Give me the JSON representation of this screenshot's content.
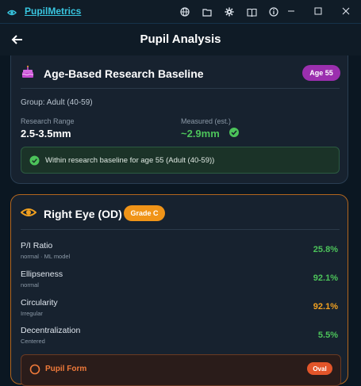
{
  "window": {
    "app_name": "PupilMetrics",
    "toolbar_icons": [
      "globe-icon",
      "folder-icon",
      "gear-icon",
      "book-icon",
      "info-icon"
    ],
    "controls": [
      "minimize",
      "maximize",
      "close"
    ]
  },
  "header": {
    "title": "Pupil Analysis"
  },
  "baseline_card": {
    "title": "Age-Based Research Baseline",
    "age_badge": "Age 55",
    "group": "Group: Adult (40-59)",
    "range_label": "Research Range",
    "range_value": "2.5-3.5mm",
    "measured_label": "Measured (est.)",
    "measured_value": "~2.9mm",
    "status_text": "Within research baseline for age 55 (Adult (40-59))"
  },
  "eye_card": {
    "title": "Right Eye (OD)",
    "grade_badge": "Grade C",
    "metrics": [
      {
        "label": "P/I Ratio",
        "sub": "normal · ML model",
        "value": "25.8%",
        "color": "#4cc35a"
      },
      {
        "label": "Ellipseness",
        "sub": "normal",
        "value": "92.1%",
        "color": "#4cc35a"
      },
      {
        "label": "Circularity",
        "sub": "Irregular",
        "value": "92.1%",
        "color": "#f0a020"
      },
      {
        "label": "Decentralization",
        "sub": "Centered",
        "value": "5.5%",
        "color": "#4cc35a"
      }
    ],
    "pupil_form_label": "Pupil Form",
    "pupil_form_badge": "Oval"
  },
  "colors": {
    "accent": "#38c6e0",
    "ok_green": "#4cc35a",
    "warning_orange": "#f0a020",
    "age_badge": "#9b2fae",
    "grade_badge": "#f09418",
    "form_badge": "#e2552a"
  }
}
